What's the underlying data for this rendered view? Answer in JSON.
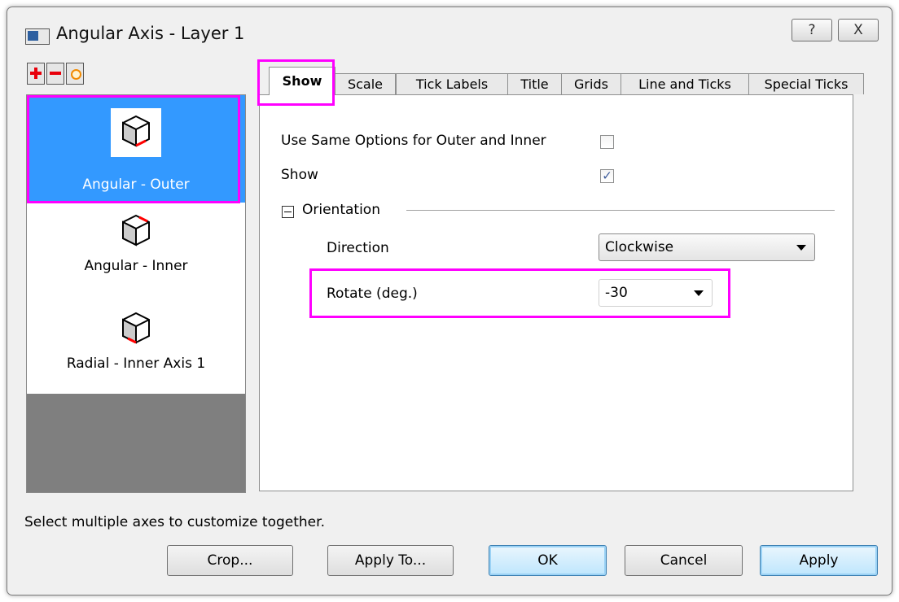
{
  "window": {
    "title": "Angular Axis - Layer 1",
    "help_glyph": "?",
    "close_glyph": "X"
  },
  "axis_list": {
    "items": [
      {
        "label": "Angular - Outer",
        "selected": true
      },
      {
        "label": "Angular - Inner",
        "selected": false
      },
      {
        "label": "Radial - Inner Axis 1",
        "selected": false
      }
    ]
  },
  "tabs": [
    {
      "label": "Show",
      "active": true
    },
    {
      "label": "Scale"
    },
    {
      "label": "Tick Labels"
    },
    {
      "label": "Title"
    },
    {
      "label": "Grids"
    },
    {
      "label": "Line and Ticks"
    },
    {
      "label": "Special Ticks"
    }
  ],
  "show_tab": {
    "same_options_label": "Use Same Options for Outer and Inner",
    "same_options_checked": false,
    "show_label": "Show",
    "show_checked": true,
    "check_glyph": "✓",
    "orientation_label": "Orientation",
    "direction_label": "Direction",
    "direction_value": "Clockwise",
    "rotate_label": "Rotate (deg.)",
    "rotate_value": "-30"
  },
  "status_text": "Select multiple axes to customize together.",
  "buttons": {
    "crop": "Crop...",
    "apply_to": "Apply To...",
    "ok": "OK",
    "cancel": "Cancel",
    "apply": "Apply"
  },
  "colors": {
    "selection": "#3399ff",
    "highlight": "#ff00ff",
    "axis_accent": "#ff0000"
  }
}
